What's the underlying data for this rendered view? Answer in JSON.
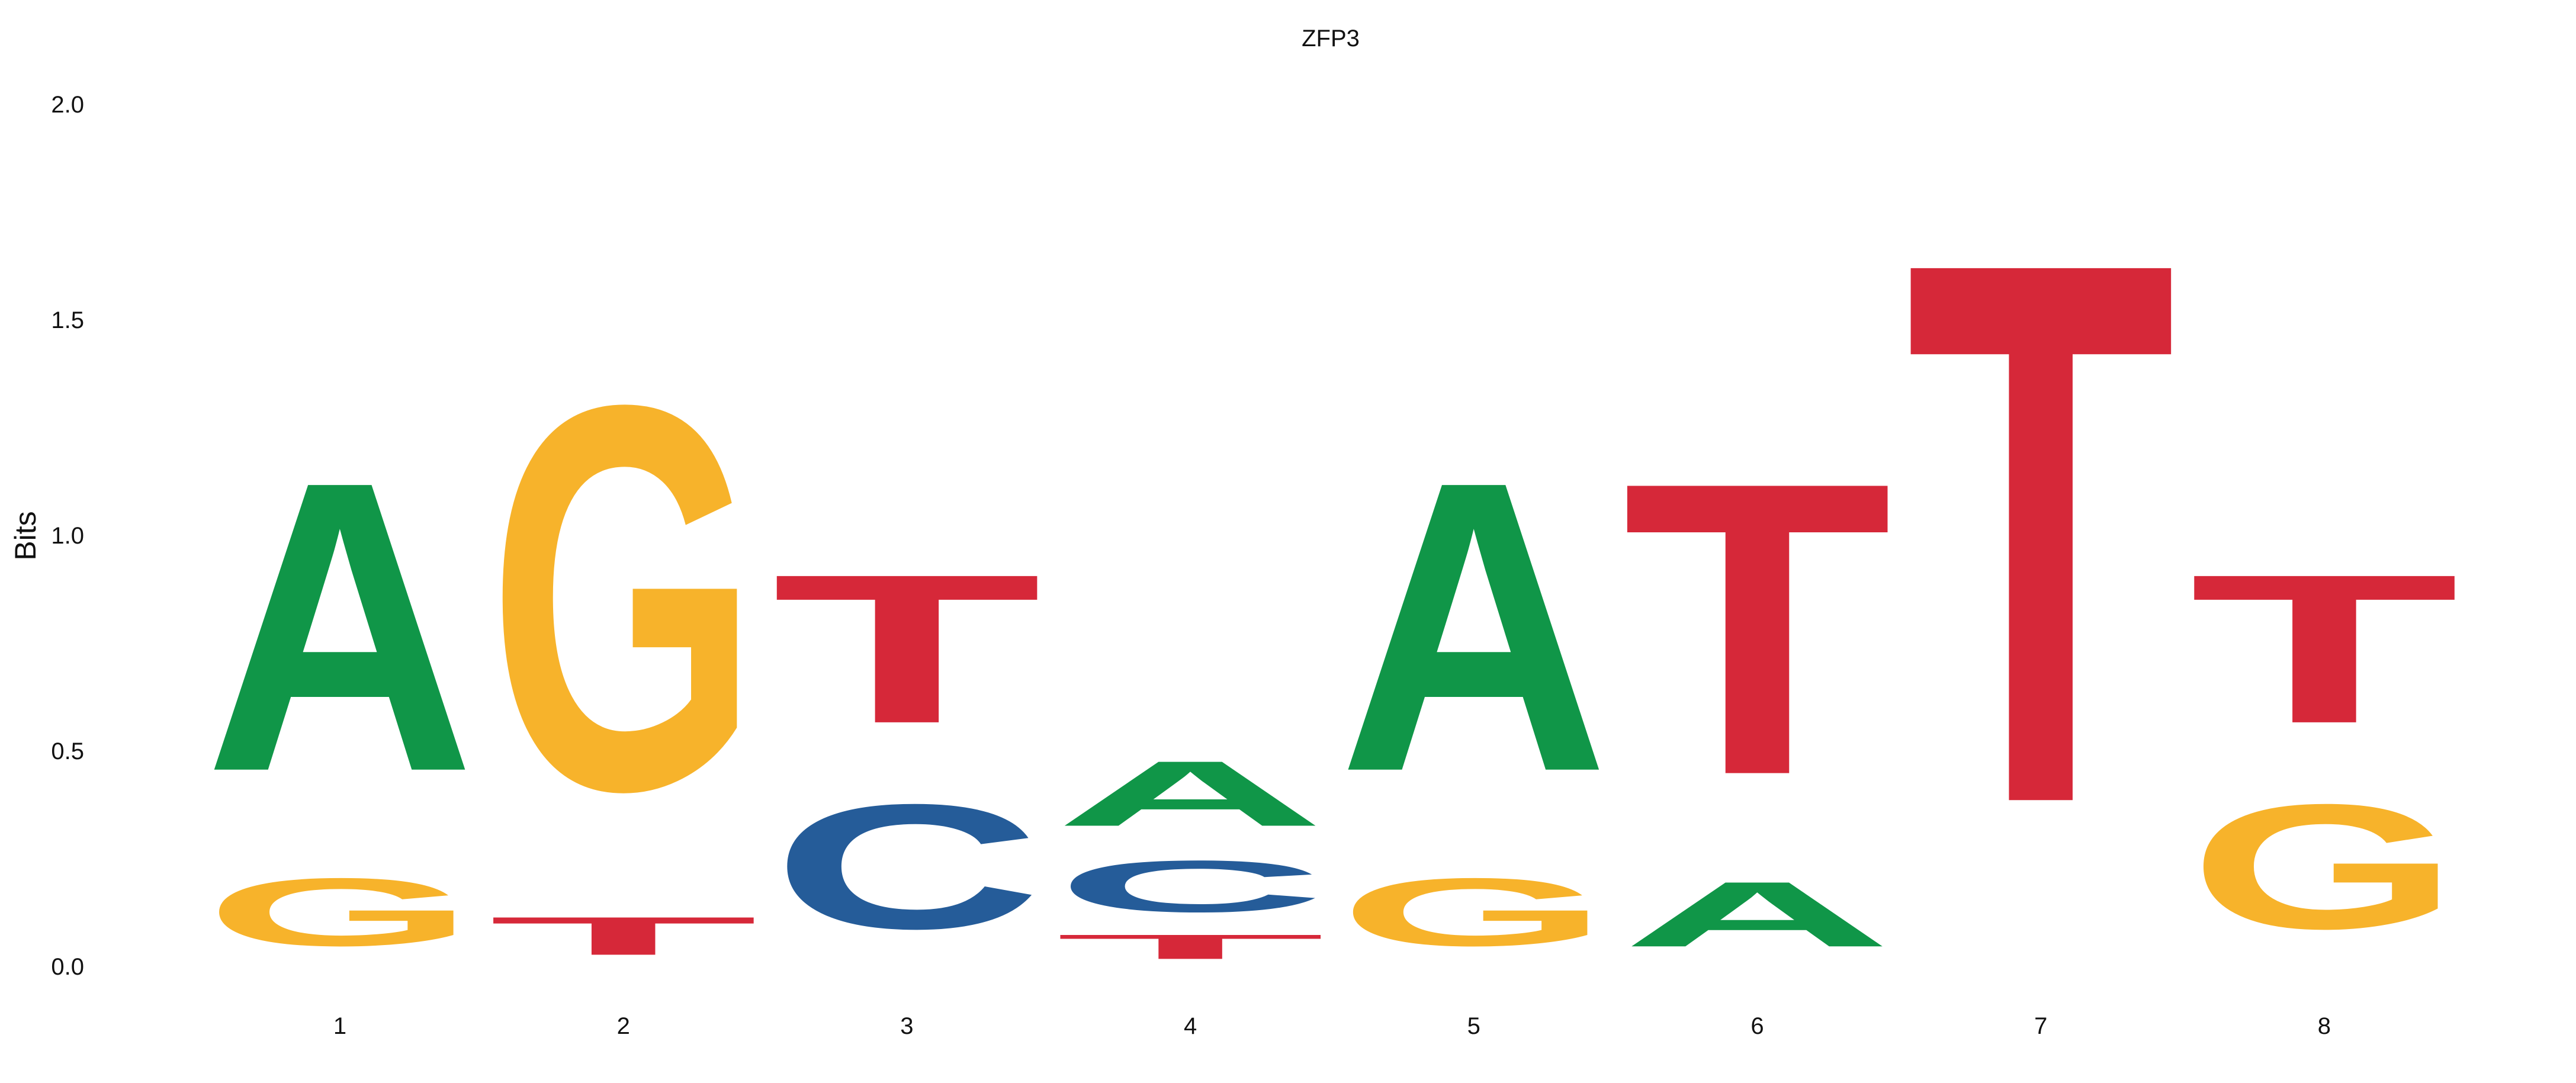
{
  "chart_data": {
    "type": "sequence-logo",
    "title": "ZFP3",
    "xlabel": "",
    "ylabel": "Bits",
    "ylim": [
      0,
      2.0
    ],
    "yticks": [
      "0.0",
      "0.5",
      "1.0",
      "1.5",
      "2.0"
    ],
    "ytick_values": [
      0,
      0.5,
      1.0,
      1.5,
      2.0
    ],
    "positions": [
      "1",
      "2",
      "3",
      "4",
      "5",
      "6",
      "7",
      "8"
    ],
    "colors": {
      "A": "#109648",
      "C": "#255C99",
      "G": "#F7B32B",
      "T": "#D62839"
    },
    "columns": [
      [
        {
          "letter": "G",
          "bits": 0.25
        },
        {
          "letter": "A",
          "bits": 1.07
        }
      ],
      [
        {
          "letter": "T",
          "bits": 0.14
        },
        {
          "letter": "G",
          "bits": 1.42
        }
      ],
      [
        {
          "letter": "C",
          "bits": 0.46
        },
        {
          "letter": "T",
          "bits": 0.55
        }
      ],
      [
        {
          "letter": "T",
          "bits": 0.09
        },
        {
          "letter": "C",
          "bits": 0.19
        },
        {
          "letter": "A",
          "bits": 0.24
        }
      ],
      [
        {
          "letter": "G",
          "bits": 0.25
        },
        {
          "letter": "A",
          "bits": 1.07
        }
      ],
      [
        {
          "letter": "A",
          "bits": 0.24
        },
        {
          "letter": "T",
          "bits": 1.08
        }
      ],
      [
        {
          "letter": "T",
          "bits": 2.0
        }
      ],
      [
        {
          "letter": "G",
          "bits": 0.46
        },
        {
          "letter": "T",
          "bits": 0.55
        }
      ]
    ]
  }
}
